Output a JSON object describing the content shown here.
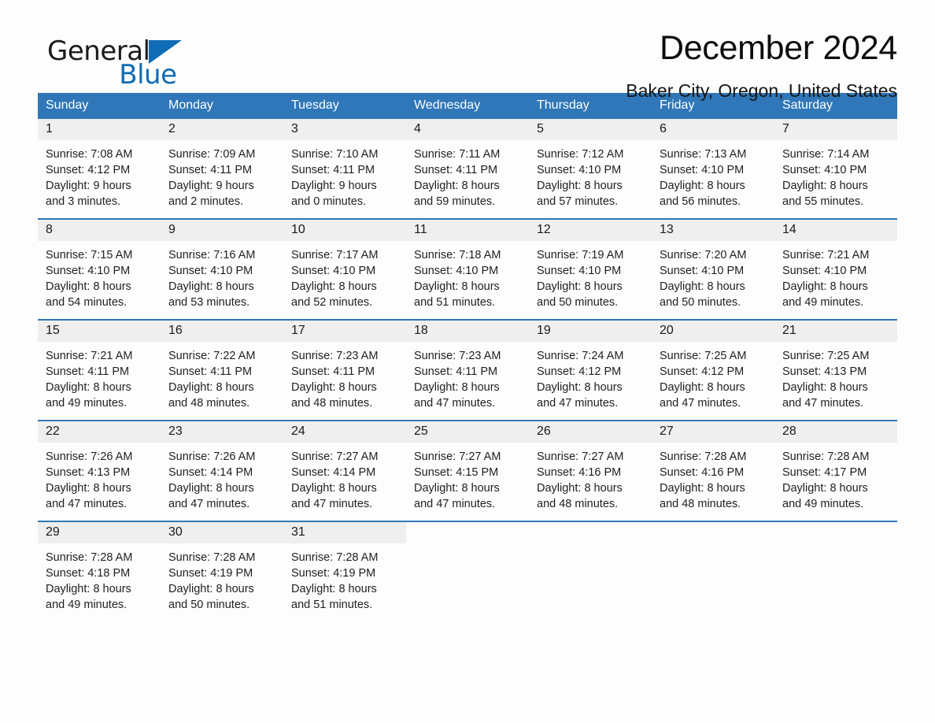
{
  "brand": {
    "word1": "General",
    "word2": "Blue",
    "triangle_color": "#0f6cb5"
  },
  "header": {
    "title": "December 2024",
    "subtitle": "Baker City, Oregon, United States"
  },
  "theme": {
    "header_blue": "#2f77b8",
    "daynum_band": "#efefef",
    "page_background": "#fdfdfd",
    "text": "#1a1a1a"
  },
  "calendar": {
    "weekday_headers": [
      "Sunday",
      "Monday",
      "Tuesday",
      "Wednesday",
      "Thursday",
      "Friday",
      "Saturday"
    ],
    "weeks": [
      [
        {
          "day": "1",
          "sunrise": "Sunrise: 7:08 AM",
          "sunset": "Sunset: 4:12 PM",
          "daylight_line1": "Daylight: 9 hours",
          "daylight_line2": "and 3 minutes."
        },
        {
          "day": "2",
          "sunrise": "Sunrise: 7:09 AM",
          "sunset": "Sunset: 4:11 PM",
          "daylight_line1": "Daylight: 9 hours",
          "daylight_line2": "and 2 minutes."
        },
        {
          "day": "3",
          "sunrise": "Sunrise: 7:10 AM",
          "sunset": "Sunset: 4:11 PM",
          "daylight_line1": "Daylight: 9 hours",
          "daylight_line2": "and 0 minutes."
        },
        {
          "day": "4",
          "sunrise": "Sunrise: 7:11 AM",
          "sunset": "Sunset: 4:11 PM",
          "daylight_line1": "Daylight: 8 hours",
          "daylight_line2": "and 59 minutes."
        },
        {
          "day": "5",
          "sunrise": "Sunrise: 7:12 AM",
          "sunset": "Sunset: 4:10 PM",
          "daylight_line1": "Daylight: 8 hours",
          "daylight_line2": "and 57 minutes."
        },
        {
          "day": "6",
          "sunrise": "Sunrise: 7:13 AM",
          "sunset": "Sunset: 4:10 PM",
          "daylight_line1": "Daylight: 8 hours",
          "daylight_line2": "and 56 minutes."
        },
        {
          "day": "7",
          "sunrise": "Sunrise: 7:14 AM",
          "sunset": "Sunset: 4:10 PM",
          "daylight_line1": "Daylight: 8 hours",
          "daylight_line2": "and 55 minutes."
        }
      ],
      [
        {
          "day": "8",
          "sunrise": "Sunrise: 7:15 AM",
          "sunset": "Sunset: 4:10 PM",
          "daylight_line1": "Daylight: 8 hours",
          "daylight_line2": "and 54 minutes."
        },
        {
          "day": "9",
          "sunrise": "Sunrise: 7:16 AM",
          "sunset": "Sunset: 4:10 PM",
          "daylight_line1": "Daylight: 8 hours",
          "daylight_line2": "and 53 minutes."
        },
        {
          "day": "10",
          "sunrise": "Sunrise: 7:17 AM",
          "sunset": "Sunset: 4:10 PM",
          "daylight_line1": "Daylight: 8 hours",
          "daylight_line2": "and 52 minutes."
        },
        {
          "day": "11",
          "sunrise": "Sunrise: 7:18 AM",
          "sunset": "Sunset: 4:10 PM",
          "daylight_line1": "Daylight: 8 hours",
          "daylight_line2": "and 51 minutes."
        },
        {
          "day": "12",
          "sunrise": "Sunrise: 7:19 AM",
          "sunset": "Sunset: 4:10 PM",
          "daylight_line1": "Daylight: 8 hours",
          "daylight_line2": "and 50 minutes."
        },
        {
          "day": "13",
          "sunrise": "Sunrise: 7:20 AM",
          "sunset": "Sunset: 4:10 PM",
          "daylight_line1": "Daylight: 8 hours",
          "daylight_line2": "and 50 minutes."
        },
        {
          "day": "14",
          "sunrise": "Sunrise: 7:21 AM",
          "sunset": "Sunset: 4:10 PM",
          "daylight_line1": "Daylight: 8 hours",
          "daylight_line2": "and 49 minutes."
        }
      ],
      [
        {
          "day": "15",
          "sunrise": "Sunrise: 7:21 AM",
          "sunset": "Sunset: 4:11 PM",
          "daylight_line1": "Daylight: 8 hours",
          "daylight_line2": "and 49 minutes."
        },
        {
          "day": "16",
          "sunrise": "Sunrise: 7:22 AM",
          "sunset": "Sunset: 4:11 PM",
          "daylight_line1": "Daylight: 8 hours",
          "daylight_line2": "and 48 minutes."
        },
        {
          "day": "17",
          "sunrise": "Sunrise: 7:23 AM",
          "sunset": "Sunset: 4:11 PM",
          "daylight_line1": "Daylight: 8 hours",
          "daylight_line2": "and 48 minutes."
        },
        {
          "day": "18",
          "sunrise": "Sunrise: 7:23 AM",
          "sunset": "Sunset: 4:11 PM",
          "daylight_line1": "Daylight: 8 hours",
          "daylight_line2": "and 47 minutes."
        },
        {
          "day": "19",
          "sunrise": "Sunrise: 7:24 AM",
          "sunset": "Sunset: 4:12 PM",
          "daylight_line1": "Daylight: 8 hours",
          "daylight_line2": "and 47 minutes."
        },
        {
          "day": "20",
          "sunrise": "Sunrise: 7:25 AM",
          "sunset": "Sunset: 4:12 PM",
          "daylight_line1": "Daylight: 8 hours",
          "daylight_line2": "and 47 minutes."
        },
        {
          "day": "21",
          "sunrise": "Sunrise: 7:25 AM",
          "sunset": "Sunset: 4:13 PM",
          "daylight_line1": "Daylight: 8 hours",
          "daylight_line2": "and 47 minutes."
        }
      ],
      [
        {
          "day": "22",
          "sunrise": "Sunrise: 7:26 AM",
          "sunset": "Sunset: 4:13 PM",
          "daylight_line1": "Daylight: 8 hours",
          "daylight_line2": "and 47 minutes."
        },
        {
          "day": "23",
          "sunrise": "Sunrise: 7:26 AM",
          "sunset": "Sunset: 4:14 PM",
          "daylight_line1": "Daylight: 8 hours",
          "daylight_line2": "and 47 minutes."
        },
        {
          "day": "24",
          "sunrise": "Sunrise: 7:27 AM",
          "sunset": "Sunset: 4:14 PM",
          "daylight_line1": "Daylight: 8 hours",
          "daylight_line2": "and 47 minutes."
        },
        {
          "day": "25",
          "sunrise": "Sunrise: 7:27 AM",
          "sunset": "Sunset: 4:15 PM",
          "daylight_line1": "Daylight: 8 hours",
          "daylight_line2": "and 47 minutes."
        },
        {
          "day": "26",
          "sunrise": "Sunrise: 7:27 AM",
          "sunset": "Sunset: 4:16 PM",
          "daylight_line1": "Daylight: 8 hours",
          "daylight_line2": "and 48 minutes."
        },
        {
          "day": "27",
          "sunrise": "Sunrise: 7:28 AM",
          "sunset": "Sunset: 4:16 PM",
          "daylight_line1": "Daylight: 8 hours",
          "daylight_line2": "and 48 minutes."
        },
        {
          "day": "28",
          "sunrise": "Sunrise: 7:28 AM",
          "sunset": "Sunset: 4:17 PM",
          "daylight_line1": "Daylight: 8 hours",
          "daylight_line2": "and 49 minutes."
        }
      ],
      [
        {
          "day": "29",
          "sunrise": "Sunrise: 7:28 AM",
          "sunset": "Sunset: 4:18 PM",
          "daylight_line1": "Daylight: 8 hours",
          "daylight_line2": "and 49 minutes."
        },
        {
          "day": "30",
          "sunrise": "Sunrise: 7:28 AM",
          "sunset": "Sunset: 4:19 PM",
          "daylight_line1": "Daylight: 8 hours",
          "daylight_line2": "and 50 minutes."
        },
        {
          "day": "31",
          "sunrise": "Sunrise: 7:28 AM",
          "sunset": "Sunset: 4:19 PM",
          "daylight_line1": "Daylight: 8 hours",
          "daylight_line2": "and 51 minutes."
        },
        {
          "day": "",
          "sunrise": "",
          "sunset": "",
          "daylight_line1": "",
          "daylight_line2": ""
        },
        {
          "day": "",
          "sunrise": "",
          "sunset": "",
          "daylight_line1": "",
          "daylight_line2": ""
        },
        {
          "day": "",
          "sunrise": "",
          "sunset": "",
          "daylight_line1": "",
          "daylight_line2": ""
        },
        {
          "day": "",
          "sunrise": "",
          "sunset": "",
          "daylight_line1": "",
          "daylight_line2": ""
        }
      ]
    ]
  }
}
